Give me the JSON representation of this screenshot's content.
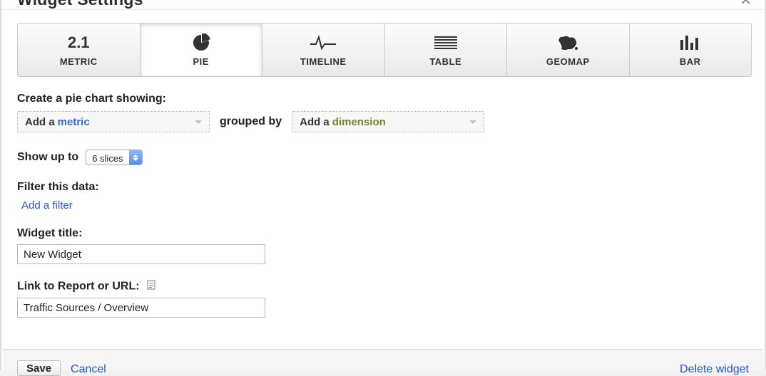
{
  "dialog_title": "Widget Settings",
  "tabs": {
    "metric": {
      "label": "METRIC",
      "badge": "2.1"
    },
    "pie": {
      "label": "PIE"
    },
    "timeline": {
      "label": "TIMELINE"
    },
    "table": {
      "label": "TABLE"
    },
    "geomap": {
      "label": "GEOMAP"
    },
    "bar": {
      "label": "BAR"
    }
  },
  "active_tab": "pie",
  "pie_form": {
    "prompt": "Create a pie chart showing:",
    "metric_dropdown_prefix": "Add a",
    "metric_dropdown_term": "metric",
    "grouped_by_label": "grouped by",
    "dimension_dropdown_prefix": "Add a",
    "dimension_dropdown_term": "dimension",
    "show_up_to_label": "Show up to",
    "slices_value": "6 slices",
    "filter_label": "Filter this data:",
    "add_filter_link": "Add a filter",
    "title_label": "Widget title:",
    "title_value": "New Widget",
    "link_label": "Link to Report or URL:",
    "link_value": "Traffic Sources / Overview"
  },
  "footer": {
    "save": "Save",
    "cancel": "Cancel",
    "delete": "Delete widget"
  }
}
